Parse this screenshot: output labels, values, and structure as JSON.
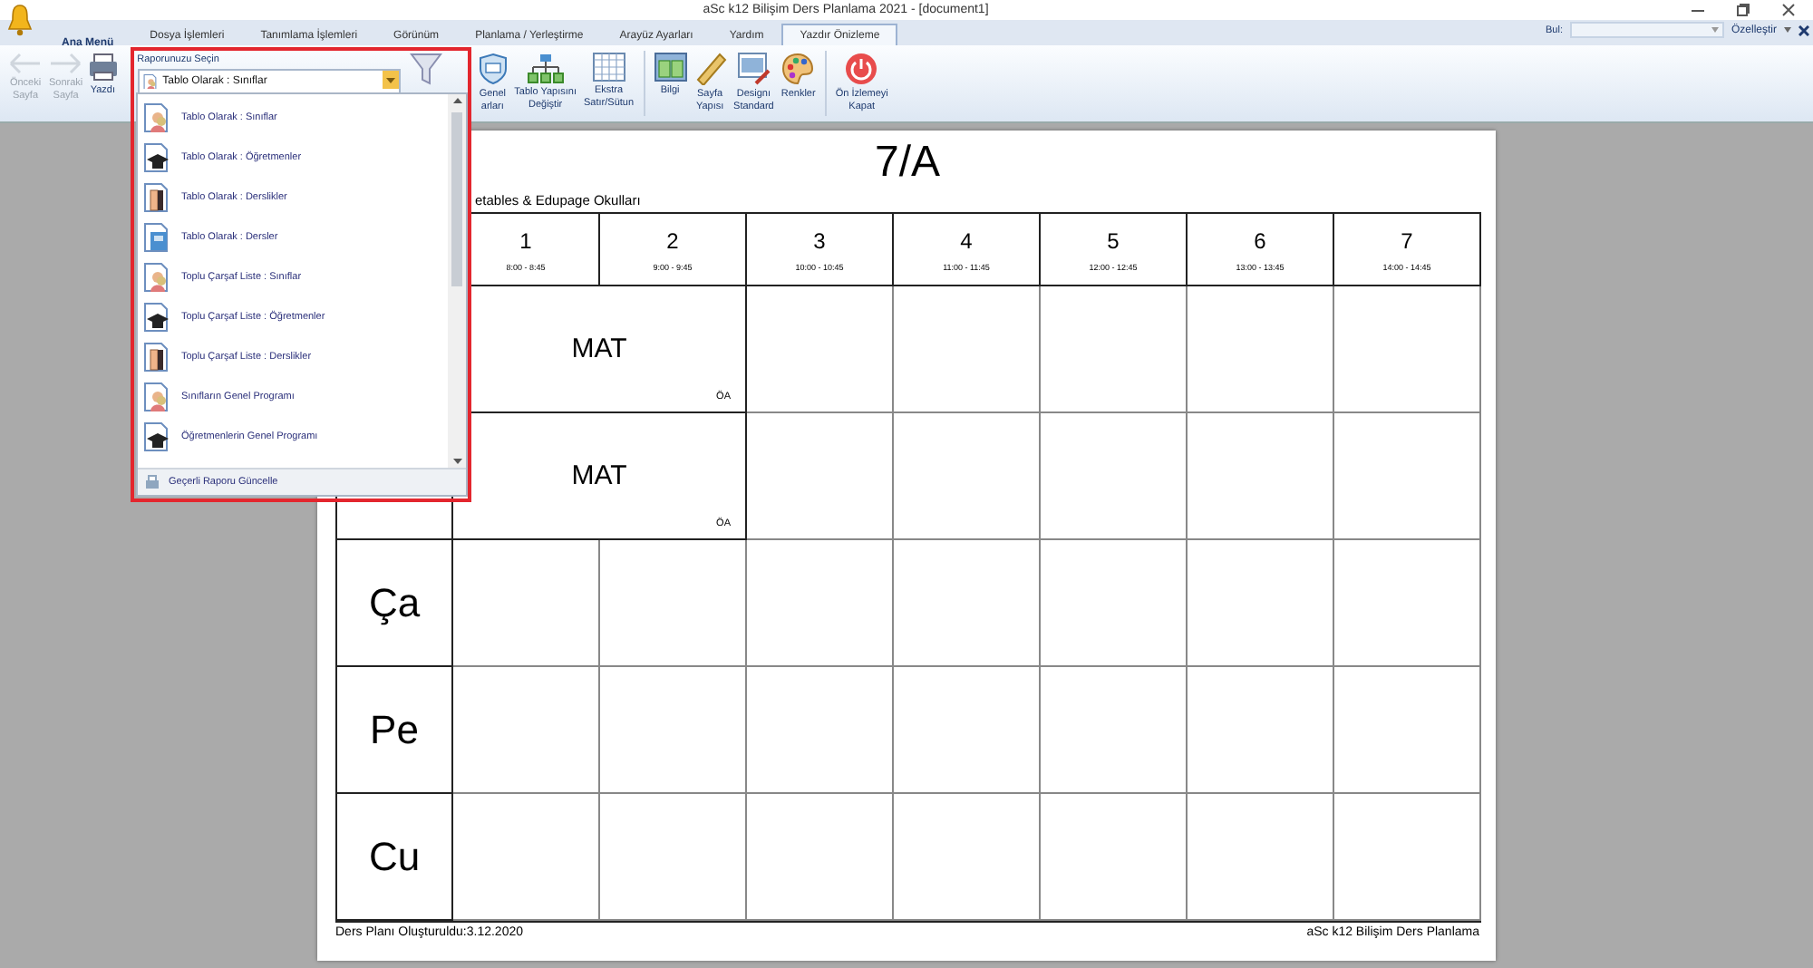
{
  "window": {
    "title": "aSc k12 Bilişim Ders Planlama 2021  - [document1]"
  },
  "tabs": [
    {
      "label": "Ana Menü",
      "selected": false,
      "kind": "main"
    },
    {
      "label": "Dosya İşlemleri",
      "selected": false,
      "kind": "tab"
    },
    {
      "label": "Tanımlama İşlemleri",
      "selected": false,
      "kind": "tab"
    },
    {
      "label": "Görünüm",
      "selected": false,
      "kind": "tab"
    },
    {
      "label": "Planlama / Yerleştirme",
      "selected": false,
      "kind": "tab"
    },
    {
      "label": "Arayüz Ayarları",
      "selected": false,
      "kind": "tab"
    },
    {
      "label": "Yardım",
      "selected": false,
      "kind": "tab"
    },
    {
      "label": "Yazdır Önizleme",
      "selected": true,
      "kind": "tab"
    }
  ],
  "find": {
    "label": "Bul:"
  },
  "customize": {
    "label": "Özelleştir"
  },
  "ribbon": [
    {
      "kind": "back",
      "lines": [
        "Önceki",
        "Sayfa"
      ],
      "disabled": true
    },
    {
      "kind": "forward",
      "lines": [
        "Sonraki",
        "Sayfa"
      ],
      "disabled": true
    },
    {
      "kind": "printer",
      "lines": [
        "Yazdı"
      ],
      "disabled": false
    },
    {
      "kind": "report",
      "label": "Raporunuzu Seçin",
      "value": "Tablo Olarak : Sınıflar"
    },
    {
      "kind": "filter",
      "disabled": false
    },
    {
      "kind": "shield",
      "lines": [
        "Genel",
        "arları"
      ],
      "disabled": false
    },
    {
      "kind": "tree",
      "lines": [
        "Tablo Yapısını",
        "Değiştir"
      ],
      "disabled": false
    },
    {
      "kind": "grid",
      "lines": [
        "Ekstra",
        "Satır/Sütun"
      ],
      "disabled": false
    },
    {
      "kind": "sep"
    },
    {
      "kind": "info",
      "lines": [
        "Bilgi"
      ],
      "disabled": false
    },
    {
      "kind": "ruler",
      "lines": [
        "Sayfa",
        "Yapısı"
      ],
      "disabled": false
    },
    {
      "kind": "design",
      "lines": [
        "Designı",
        "Standard"
      ],
      "disabled": false
    },
    {
      "kind": "palette",
      "lines": [
        "Renkler"
      ],
      "disabled": false
    },
    {
      "kind": "sep"
    },
    {
      "kind": "power",
      "lines": [
        "Ön İzlemeyi",
        "Kapat"
      ],
      "disabled": false
    }
  ],
  "report_list": {
    "items": [
      {
        "label": "Tablo Olarak : Sınıflar",
        "kind": "class"
      },
      {
        "label": "Tablo Olarak : Öğretmenler",
        "kind": "teacher"
      },
      {
        "label": "Tablo Olarak : Derslikler",
        "kind": "room"
      },
      {
        "label": "Tablo Olarak : Dersler",
        "kind": "subject"
      },
      {
        "label": "Toplu Çarşaf Liste : Sınıflar",
        "kind": "class"
      },
      {
        "label": "Toplu Çarşaf Liste : Öğretmenler",
        "kind": "teacher"
      },
      {
        "label": "Toplu Çarşaf Liste : Derslikler",
        "kind": "room"
      },
      {
        "label": "Sınıfların Genel Programı",
        "kind": "class"
      },
      {
        "label": "Öğretmenlerin Genel Programı",
        "kind": "teacher"
      }
    ],
    "footer": "Geçerli Raporu Güncelle"
  },
  "page": {
    "title": "7/A",
    "subtitle": "etables & Edupage Okulları",
    "periods": [
      {
        "number": "1",
        "time": "8:00 - 8:45"
      },
      {
        "number": "2",
        "time": "9:00 - 9:45"
      },
      {
        "number": "3",
        "time": "10:00 - 10:45"
      },
      {
        "number": "4",
        "time": "11:00 - 11:45"
      },
      {
        "number": "5",
        "time": "12:00 - 12:45"
      },
      {
        "number": "6",
        "time": "13:00 - 13:45"
      },
      {
        "number": "7",
        "time": "14:00 - 14:45"
      }
    ],
    "rows": [
      {
        "cells": [
          {
            "kind": "lesson",
            "subject": "MAT",
            "teacher": "ÖA",
            "double": true
          },
          {
            "kind": "empty"
          },
          {
            "kind": "empty"
          },
          {
            "kind": "empty"
          },
          {
            "kind": "empty"
          },
          {
            "kind": "empty"
          }
        ]
      },
      {
        "cells": [
          {
            "kind": "lesson",
            "subject": "MAT",
            "teacher": "ÖA",
            "double": true
          },
          {
            "kind": "empty"
          },
          {
            "kind": "empty"
          },
          {
            "kind": "empty"
          },
          {
            "kind": "empty"
          },
          {
            "kind": "empty"
          }
        ]
      },
      {
        "day": "Ça",
        "cells": [
          {
            "kind": "empty"
          },
          {
            "kind": "empty"
          },
          {
            "kind": "empty"
          },
          {
            "kind": "empty"
          },
          {
            "kind": "empty"
          },
          {
            "kind": "empty"
          },
          {
            "kind": "empty"
          }
        ]
      },
      {
        "day": "Pe",
        "cells": [
          {
            "kind": "empty"
          },
          {
            "kind": "empty"
          },
          {
            "kind": "empty"
          },
          {
            "kind": "empty"
          },
          {
            "kind": "empty"
          },
          {
            "kind": "empty"
          },
          {
            "kind": "empty"
          }
        ]
      },
      {
        "day": "Cu",
        "cells": [
          {
            "kind": "empty"
          },
          {
            "kind": "empty"
          },
          {
            "kind": "empty"
          },
          {
            "kind": "empty"
          },
          {
            "kind": "empty"
          },
          {
            "kind": "empty"
          },
          {
            "kind": "empty"
          }
        ]
      }
    ],
    "footer_left": "Ders Planı Oluşturuldu:3.12.2020",
    "footer_right": "aSc k12 Bilişim Ders Planlama"
  }
}
